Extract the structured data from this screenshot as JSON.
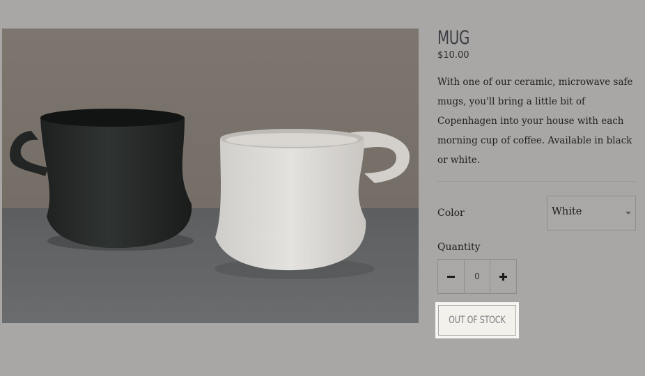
{
  "product": {
    "title": "MUG",
    "price": "$10.00",
    "description": "With one of our ceramic, microwave safe mugs, you'll bring a little bit of Copenhagen into your house with each morning cup of coffee. Available in black or white.",
    "image_subject": "black and white ceramic mugs"
  },
  "options": {
    "color_label": "Color",
    "color_selected": "White"
  },
  "quantity": {
    "label": "Quantity",
    "value": "0"
  },
  "actions": {
    "stock_button_label": "OUT OF STOCK"
  },
  "colors": {
    "background": "#a8a7a5",
    "button_bg": "#f3f1ec",
    "button_text": "#7b7d80",
    "title_text": "#3a3d42"
  }
}
